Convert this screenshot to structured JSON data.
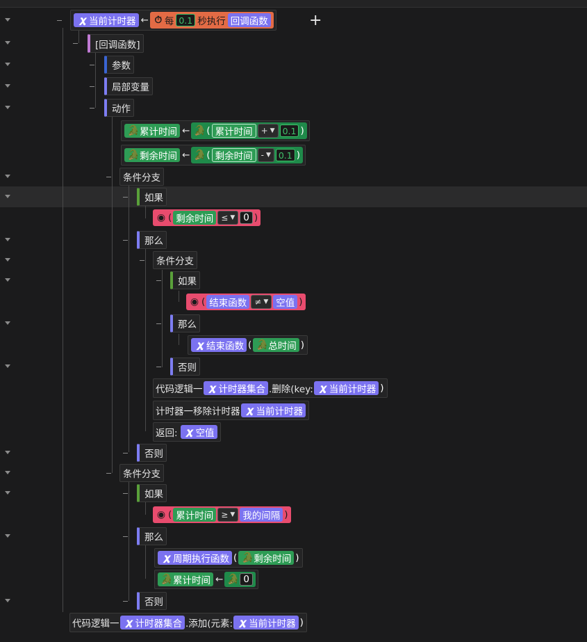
{
  "header": {
    "var": "当前计时器",
    "arrow": "←",
    "every": "每",
    "interval": "0.1",
    "exec": "秒执行",
    "callback": "回调函数",
    "add": "+"
  },
  "callback_node": "[回调函数]",
  "params": "参数",
  "locals": "局部变量",
  "actions": "动作",
  "assign1": {
    "target": "累计时间",
    "arrow": "←",
    "lhs": "累计时间",
    "op": "+",
    "rhs": "0.1"
  },
  "assign2": {
    "target": "剩余时间",
    "arrow": "←",
    "lhs": "剩余时间",
    "op": "-",
    "rhs": "0.1"
  },
  "branch1": {
    "label": "条件分支",
    "if": "如果",
    "cond": {
      "lhs": "剩余时间",
      "op": "≤",
      "rhs": "0"
    },
    "then": "那么",
    "inner": {
      "label": "条件分支",
      "if": "如果",
      "cond": {
        "lhs": "结束函数",
        "op": "≠",
        "rhs": "空值"
      },
      "then": "那么",
      "call": {
        "fn": "结束函数",
        "arg": "总时间"
      },
      "else": "否则"
    },
    "remove": {
      "prefix": "代码逻辑一",
      "obj": "计时器集合",
      "method": ".删除(key:",
      "arg": "当前计时器",
      "close": ")"
    },
    "timer_remove": {
      "label": "计时器一移除计时器",
      "arg": "当前计时器"
    },
    "ret": {
      "label": "返回:",
      "val": "空值"
    },
    "else": "否则"
  },
  "branch2": {
    "label": "条件分支",
    "if": "如果",
    "cond": {
      "lhs": "累计时间",
      "op": "≥",
      "rhs": "我的间隔"
    },
    "then": "那么",
    "call": {
      "fn": "周期执行函数",
      "arg": "剩余时间"
    },
    "assign": {
      "target": "累计时间",
      "arrow": "←",
      "val": "0"
    },
    "else": "否则"
  },
  "footer": {
    "prefix": "代码逻辑一",
    "obj": "计时器集合",
    "method": ".添加(元素:",
    "arg": "当前计时器",
    "close": ")"
  },
  "colors": {
    "var": "#7b72f0",
    "green": "#2e9c55",
    "pink": "#e84c6e",
    "orange": "#e36b45"
  }
}
